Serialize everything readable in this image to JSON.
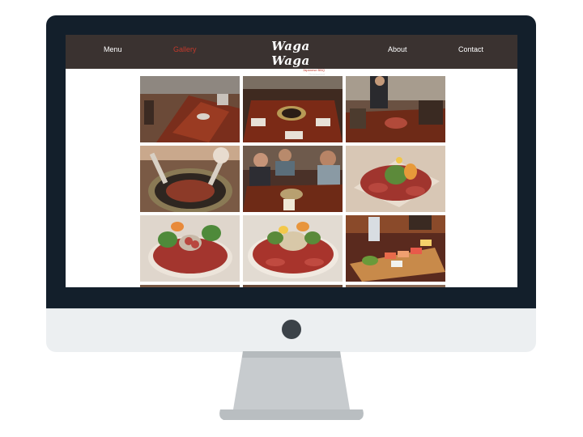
{
  "nav": {
    "items": [
      {
        "label": "Menu",
        "active": false
      },
      {
        "label": "Gallery",
        "active": true
      },
      {
        "label": "About",
        "active": false
      },
      {
        "label": "Contact",
        "active": false
      }
    ],
    "logo": {
      "name": "Waga Waga",
      "subtitle": "Japanese BBQ",
      "tagline": "Restaurant"
    }
  },
  "colors": {
    "nav_background": "#3a3230",
    "accent": "#c0392b",
    "bezel": "#131f2b"
  },
  "gallery": {
    "photos": [
      {
        "name": "dining-room-photo"
      },
      {
        "name": "table-setting-photo"
      },
      {
        "name": "group-dining-photo"
      },
      {
        "name": "grilling-meat-photo"
      },
      {
        "name": "guests-at-table-photo"
      },
      {
        "name": "wagyu-platter-photo"
      },
      {
        "name": "meat-platter-photo"
      },
      {
        "name": "deluxe-meat-platter-photo"
      },
      {
        "name": "sushi-platter-photo"
      }
    ]
  }
}
